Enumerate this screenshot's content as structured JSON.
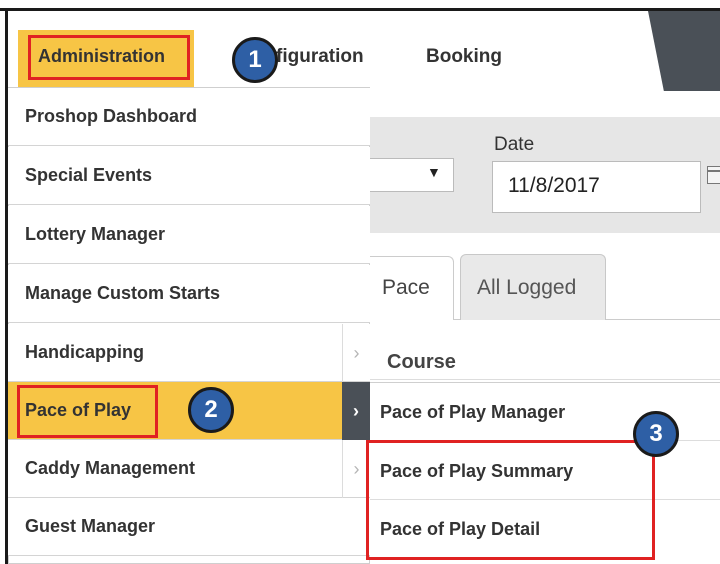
{
  "nav": {
    "tabs": [
      "Administration",
      "Configuration",
      "Booking"
    ],
    "configuration_partial": "figuration"
  },
  "filters": {
    "dropdown_arrow": "▼",
    "date_label": "Date",
    "date_value": "11/8/2017"
  },
  "content_tabs": [
    "Pace",
    "All Logged"
  ],
  "table": {
    "course_header": "Course"
  },
  "admin_menu": {
    "items": [
      {
        "label": "Proshop Dashboard",
        "has_submenu": false
      },
      {
        "label": "Special Events",
        "has_submenu": false
      },
      {
        "label": "Lottery Manager",
        "has_submenu": false
      },
      {
        "label": "Manage Custom Starts",
        "has_submenu": false
      },
      {
        "label": "Handicapping",
        "has_submenu": true
      },
      {
        "label": "Pace of Play",
        "has_submenu": true,
        "active": true
      },
      {
        "label": "Caddy Management",
        "has_submenu": true
      },
      {
        "label": "Guest Manager",
        "has_submenu": false
      }
    ],
    "submenu_arrow": "›"
  },
  "pace_submenu": {
    "items": [
      "Pace of Play Manager",
      "Pace of Play Summary",
      "Pace of Play Detail"
    ]
  },
  "steps": [
    "1",
    "2",
    "3"
  ],
  "colors": {
    "active_highlight": "#f7c545",
    "callout_box": "#e02222",
    "step_badge": "#2e5fa5",
    "dark_accent": "#4a5057"
  }
}
